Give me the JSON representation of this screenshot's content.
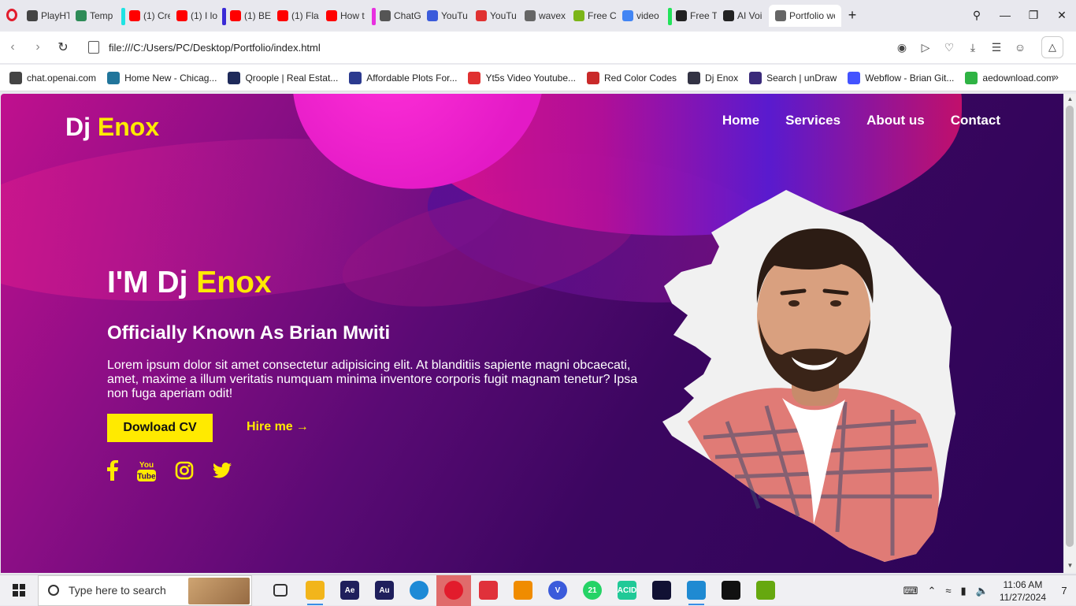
{
  "browser": {
    "tabs": [
      {
        "label": "",
        "icon": "opera-icon",
        "color": "#e21c2c"
      },
      {
        "label": "PlayHT",
        "icon": "playht-icon",
        "color": "#444444"
      },
      {
        "label": "Temp",
        "icon": "temp-icon",
        "color": "#2e8b57"
      },
      {
        "label": "(1) Cre",
        "icon": "youtube-icon",
        "color": "#ff0000",
        "group": "#1fe3e3"
      },
      {
        "label": "(1) I lo",
        "icon": "youtube-icon",
        "color": "#ff0000"
      },
      {
        "label": "(1) BE",
        "icon": "youtube-icon",
        "color": "#ff0000",
        "group": "#3b2bd6"
      },
      {
        "label": "(1) Fla",
        "icon": "youtube-icon",
        "color": "#ff0000"
      },
      {
        "label": "How t",
        "icon": "youtube-icon",
        "color": "#ff0000"
      },
      {
        "label": "ChatG",
        "icon": "chatgpt-icon",
        "color": "#555555",
        "group": "#e830e0"
      },
      {
        "label": "YouTu",
        "icon": "r-icon",
        "color": "#3b5bdb"
      },
      {
        "label": "YouTu",
        "icon": "download-icon",
        "color": "#e03131"
      },
      {
        "label": "wavex",
        "icon": "globe-icon",
        "color": "#666666"
      },
      {
        "label": "Free C",
        "icon": "android-icon",
        "color": "#7cb518"
      },
      {
        "label": "video",
        "icon": "google-icon",
        "color": "#4285f4"
      },
      {
        "label": "Free T",
        "icon": "pause-icon",
        "color": "#222222",
        "group": "#22e35a"
      },
      {
        "label": "AI Voi",
        "icon": "pause-icon",
        "color": "#222222"
      },
      {
        "label": "Portfolio we",
        "icon": "globe-icon",
        "color": "#666666",
        "active": true
      }
    ],
    "url": "file:///C:/Users/PC/Desktop/Portfolio/index.html",
    "bookmarks": [
      {
        "label": "chat.openai.com",
        "icon": "chatgpt-icon",
        "color": "#444444"
      },
      {
        "label": "Home New - Chicag...",
        "icon": "wordpress-icon",
        "color": "#21759b"
      },
      {
        "label": "Qroople | Real Estat...",
        "icon": "qroople-icon",
        "color": "#1e2a5a"
      },
      {
        "label": "Affordable Plots For...",
        "icon": "f-icon",
        "color": "#2b3a8f"
      },
      {
        "label": "Yt5s Video Youtube...",
        "icon": "yt5s-icon",
        "color": "#e03131"
      },
      {
        "label": "Red Color Codes",
        "icon": "colorgrid-icon",
        "color": "#c92a2a"
      },
      {
        "label": "Dj Enox",
        "icon": "page-icon",
        "color": "#333344"
      },
      {
        "label": "Search | unDraw",
        "icon": "undraw-icon",
        "color": "#3a2a7a"
      },
      {
        "label": "Webflow - Brian Git...",
        "icon": "webflow-icon",
        "color": "#4353ff"
      },
      {
        "label": "aedownload.com",
        "icon": "ae-icon",
        "color": "#2fb344"
      }
    ],
    "more_bookmarks": "»"
  },
  "site": {
    "logo_first": "Dj ",
    "logo_second": "Enox",
    "nav": [
      "Home",
      "Services",
      "About us",
      "Contact"
    ],
    "hero_title_first": "I'M Dj ",
    "hero_title_second": "Enox",
    "hero_subtitle": "Officially Known As Brian Mwiti",
    "hero_text": "Lorem ipsum dolor sit amet consectetur adipisicing elit. At blanditiis sapiente magni obcaecati, amet, maxime a illum veritatis numquam minima inventore corporis fugit magnam tenetur? Ipsa non fuga aperiam odit!",
    "cv_button": "Dowload CV",
    "hire_label": "Hire me",
    "hire_arrow": "→",
    "socials": [
      "facebook-icon",
      "youtube-icon",
      "instagram-icon",
      "twitter-icon"
    ],
    "youtube_text_top": "You",
    "youtube_text_bottom": "Tube",
    "accent_color": "#ffea00"
  },
  "taskbar": {
    "search_placeholder": "Type here to search",
    "apps": [
      {
        "name": "task-view-icon",
        "label": "",
        "color": "#333333"
      },
      {
        "name": "file-explorer-icon",
        "label": "",
        "color": "#f2b51b",
        "running": true
      },
      {
        "name": "after-effects-icon",
        "label": "Ae",
        "color": "#1f1f5c"
      },
      {
        "name": "audition-icon",
        "label": "Au",
        "color": "#1f1f5c"
      },
      {
        "name": "edge-icon",
        "label": "",
        "color": "#1d8ad6"
      },
      {
        "name": "opera-icon",
        "label": "",
        "color": "#e21c2c",
        "active": true
      },
      {
        "name": "screen-recorder-icon",
        "label": "",
        "color": "#e0313a"
      },
      {
        "name": "vlc-icon",
        "label": "",
        "color": "#f08c00"
      },
      {
        "name": "v-app-icon",
        "label": "V",
        "color": "#3b5bdb"
      },
      {
        "name": "whatsapp-icon",
        "label": "21",
        "color": "#25d366"
      },
      {
        "name": "acid-icon",
        "label": "ACID",
        "color": "#20c997"
      },
      {
        "name": "audio-wave-icon",
        "label": "",
        "color": "#111133"
      },
      {
        "name": "vscode-icon",
        "label": "",
        "color": "#1f8ad2",
        "running": true
      },
      {
        "name": "capcut-icon",
        "label": "",
        "color": "#111111"
      },
      {
        "name": "notepad-icon",
        "label": "",
        "color": "#66a80f"
      }
    ],
    "time": "11:06 AM",
    "date": "11/27/2024",
    "notifications": "7"
  }
}
